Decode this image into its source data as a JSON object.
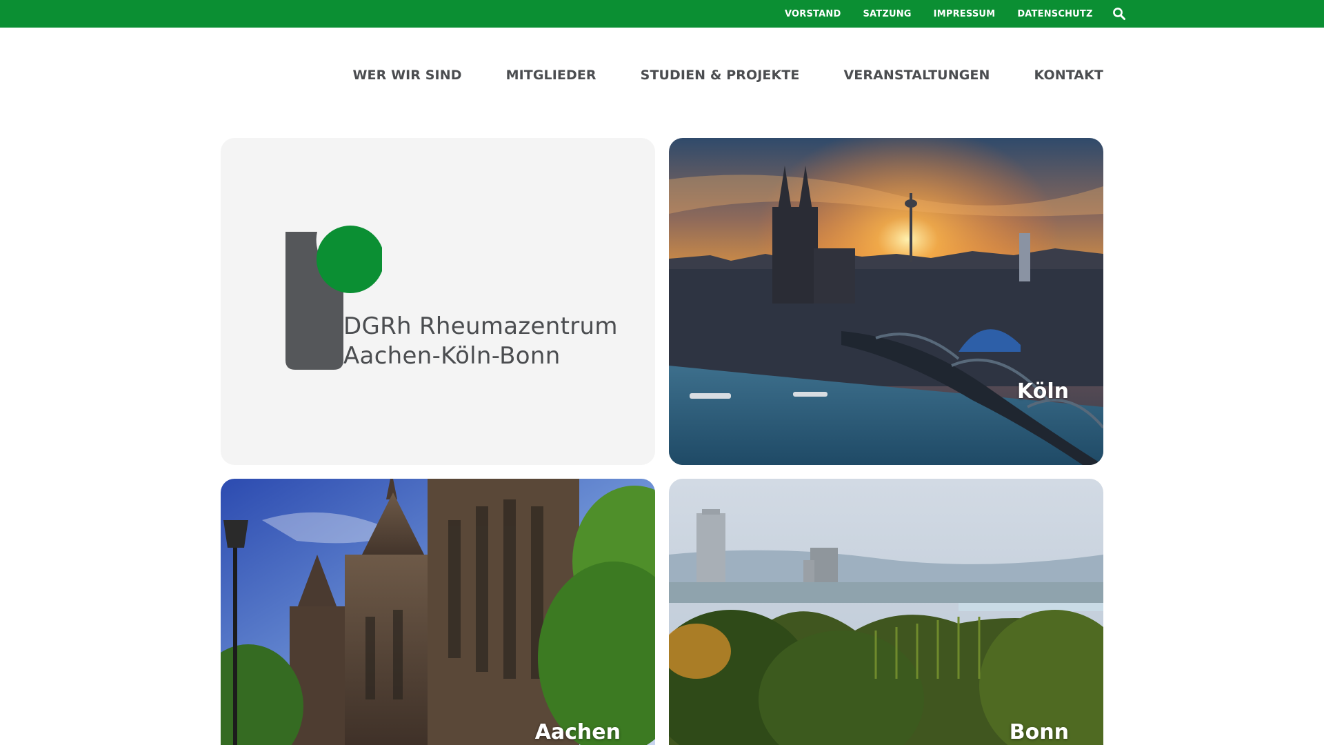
{
  "topbar": {
    "links": [
      "VORSTAND",
      "SATZUNG",
      "IMPRESSUM",
      "DATENSCHUTZ"
    ],
    "search_icon": "search-icon",
    "color": "#0b8f33"
  },
  "nav": {
    "items": [
      "WER WIR SIND",
      "MITGLIEDER",
      "STUDIEN & PROJEKTE",
      "VERANSTALTUNGEN",
      "KONTAKT"
    ]
  },
  "logo": {
    "line1": "DGRh Rheumazentrum",
    "line2": "Aachen-Köln-Bonn",
    "accent_color": "#0b8f33",
    "mark_color": "#55575a"
  },
  "tiles": {
    "koeln": "Köln",
    "aachen": "Aachen",
    "bonn": "Bonn"
  }
}
